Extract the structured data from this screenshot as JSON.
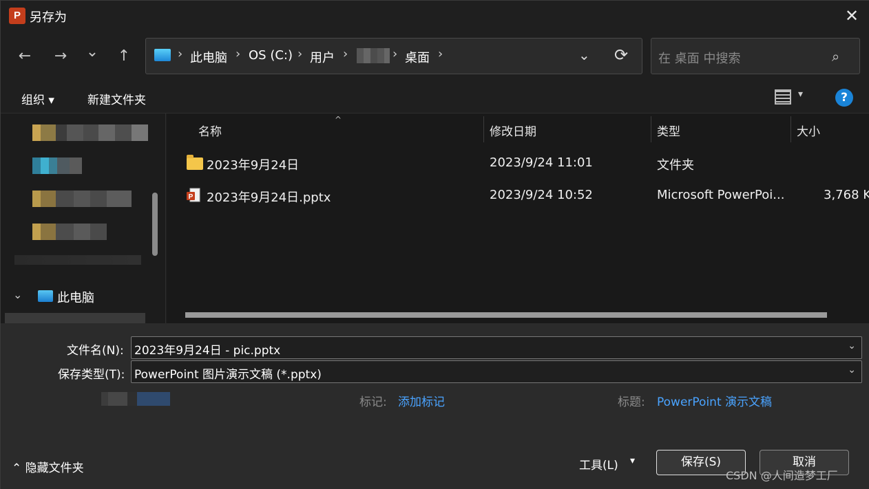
{
  "window": {
    "title": "另存为",
    "app_icon": "P",
    "close_glyph": "✕"
  },
  "nav": {
    "back_glyph": "←",
    "forward_glyph": "→",
    "recent_glyph": "⌄",
    "up_glyph": "↑",
    "breadcrumb": [
      "此电脑",
      "OS (C:)",
      "用户",
      "桌面"
    ],
    "separator": "›",
    "dropdown_glyph": "⌄",
    "refresh_glyph": "⟳",
    "search_placeholder": "在 桌面 中搜索",
    "search_glyph": "⌕"
  },
  "toolbar": {
    "organize": "组织 ▾",
    "new_folder": "新建文件夹",
    "view_dropdown": "▾",
    "help": "?"
  },
  "tree": {
    "chevron": "⌄",
    "this_pc": "此电脑"
  },
  "columns": {
    "name": "名称",
    "modified": "修改日期",
    "type": "类型",
    "size": "大小",
    "sort_glyph": "^"
  },
  "files": [
    {
      "name": "2023年9月24日",
      "modified": "2023/9/24 11:01",
      "type": "文件夹",
      "size": "",
      "icon": "folder-icon"
    },
    {
      "name": "2023年9月24日.pptx",
      "modified": "2023/9/24 10:52",
      "type": "Microsoft PowerPoi...",
      "size": "3,768 K",
      "icon": "pptx-file-icon"
    }
  ],
  "form": {
    "filename_label": "文件名(N):",
    "filename_value": "2023年9月24日 - pic.pptx",
    "filetype_label": "保存类型(T):",
    "filetype_value": "PowerPoint 图片演示文稿 (*.pptx)",
    "combo_glyph": "⌄",
    "tags_label": "标记:",
    "tags_link": "添加标记",
    "title_label": "标题:",
    "title_link": "PowerPoint 演示文稿"
  },
  "footer": {
    "hide_folders": "⌃ 隐藏文件夹",
    "tools": "工具(L)",
    "tools_dd": "▾",
    "save": "保存(S)",
    "cancel": "取消"
  },
  "watermark": "CSDN @人间造梦工厂",
  "colors": {
    "background": "#202020",
    "accent": "#1a84d8",
    "link": "#4aa3ff",
    "ppt_brand": "#c43e1c",
    "folder": "#f4c64a"
  }
}
